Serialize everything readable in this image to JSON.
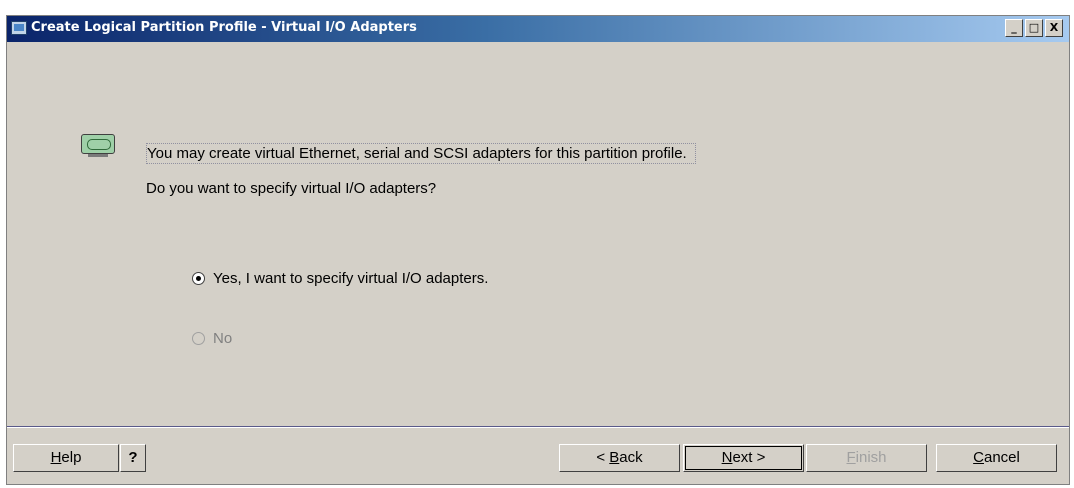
{
  "window": {
    "title": "Create Logical Partition Profile - Virtual I/O Adapters",
    "controls": {
      "minimize": "_",
      "maximize": "□",
      "close": "X"
    }
  },
  "content": {
    "info_icon": "network-adapter-icon",
    "line1": "You may create virtual Ethernet, serial and SCSI adapters for this partition profile.",
    "line2": "Do you want to specify virtual I/O adapters?"
  },
  "options": [
    {
      "label": "Yes, I want to specify virtual I/O adapters.",
      "selected": true,
      "enabled": true
    },
    {
      "label": "No",
      "selected": false,
      "enabled": false
    }
  ],
  "buttons": {
    "help": {
      "first": "H",
      "rest": "elp"
    },
    "question": "?",
    "back": {
      "prefix": "< ",
      "first": "B",
      "rest": "ack"
    },
    "next": {
      "first": "N",
      "rest": "ext >"
    },
    "finish": {
      "first": "F",
      "rest": "inish"
    },
    "cancel": {
      "first": "C",
      "rest": "ancel"
    }
  }
}
